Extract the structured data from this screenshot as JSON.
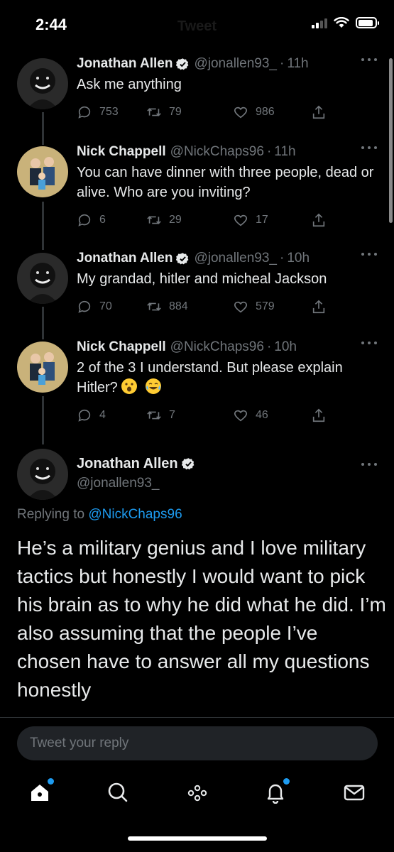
{
  "status_bar": {
    "time": "2:44",
    "header": "Tweet",
    "battery_level": 0.9
  },
  "tweets": [
    {
      "name": "Jonathan Allen",
      "verified": true,
      "handle": "@jonallen93_",
      "time": "11h",
      "text": "Ask me anything",
      "replies": "753",
      "retweets": "79",
      "likes": "986"
    },
    {
      "name": "Nick Chappell",
      "verified": false,
      "handle": "@NickChaps96",
      "time": "11h",
      "text": "You can have dinner with three people, dead or alive. Who are you inviting?",
      "replies": "6",
      "retweets": "29",
      "likes": "17"
    },
    {
      "name": "Jonathan Allen",
      "verified": true,
      "handle": "@jonallen93_",
      "time": "10h",
      "text": "My grandad, hitler and micheal Jackson",
      "replies": "70",
      "retweets": "884",
      "likes": "579"
    },
    {
      "name": "Nick Chappell",
      "verified": false,
      "handle": "@NickChaps96",
      "time": "10h",
      "text": "2 of the 3 I understand. But please explain Hitler?",
      "emojis": [
        "face-with-open-mouth",
        "face-with-tears-of-joy"
      ],
      "replies": "4",
      "retweets": "7",
      "likes": "46"
    }
  ],
  "main_tweet": {
    "name": "Jonathan Allen",
    "handle": "@jonallen93_",
    "replying_prefix": "Replying to",
    "replying_to": "@NickChaps96",
    "text": "He’s a military genius and I love military tactics but honestly I would want to pick his brain as to why he did what he did. I’m also assuming that the people I’ve chosen have to answer all my questions honestly"
  },
  "reply_box": {
    "placeholder": "Tweet your reply"
  },
  "tabs": [
    "home-icon",
    "search-icon",
    "spaces-icon",
    "notifications-icon",
    "messages-icon"
  ],
  "colors": {
    "accent": "#1d9bf0",
    "muted": "#71767b",
    "background": "#000000"
  }
}
